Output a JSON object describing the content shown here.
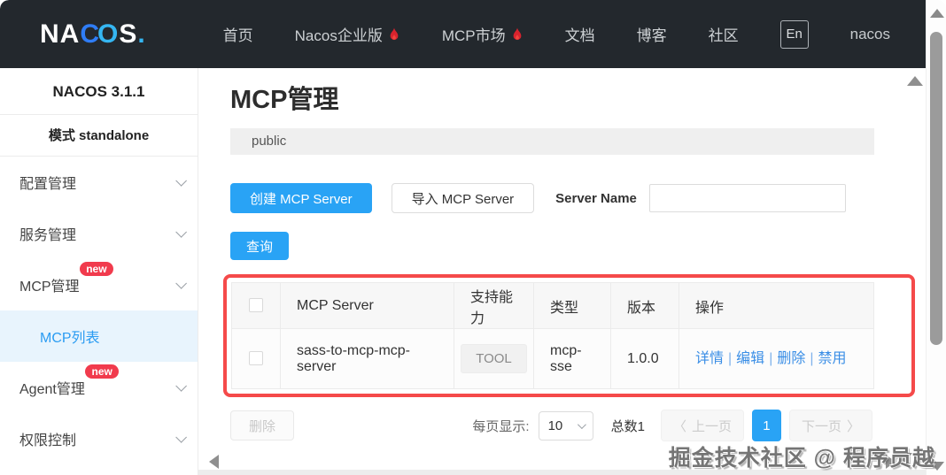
{
  "navbar": {
    "logo": {
      "na": "NA",
      "c": "C",
      "o": "O",
      "s": "S",
      "dot": "."
    },
    "menu": [
      {
        "label": "首页"
      },
      {
        "label": "Nacos企业版"
      },
      {
        "label": "MCP市场"
      },
      {
        "label": "文档"
      },
      {
        "label": "博客"
      },
      {
        "label": "社区"
      }
    ],
    "lang_button": "En",
    "username": "nacos"
  },
  "sidebar": {
    "version": "NACOS 3.1.1",
    "mode": "模式 standalone",
    "items": [
      {
        "label": "配置管理"
      },
      {
        "label": "服务管理"
      },
      {
        "label": "MCP管理",
        "badge": "new"
      },
      {
        "label": "Agent管理",
        "badge": "new"
      },
      {
        "label": "权限控制"
      }
    ],
    "submenu_selected": "MCP列表"
  },
  "main": {
    "title": "MCP管理",
    "namespace": "public",
    "toolbar": {
      "create_label": "创建 MCP Server",
      "import_label": "导入 MCP Server",
      "server_name_label": "Server Name",
      "search_value": "",
      "query_label": "查询"
    },
    "table": {
      "headers": [
        "MCP Server",
        "支持能力",
        "类型",
        "版本",
        "操作"
      ],
      "action_separator": "|",
      "rows": [
        {
          "name": "sass-to-mcp-mcp-server",
          "capability": "TOOL",
          "type": "mcp-sse",
          "version": "1.0.0",
          "actions": [
            "详情",
            "编辑",
            "删除",
            "禁用"
          ]
        }
      ]
    },
    "footer": {
      "delete_label": "删除",
      "page_size_label": "每页显示:",
      "page_size": "10",
      "total": "总数1",
      "prev_arrow": "〈",
      "prev_label": "上一页",
      "current_page": "1",
      "next_label": "下一页",
      "next_arrow": "〉"
    }
  },
  "watermark": "掘金技术社区 @ 程序员越",
  "colors": {
    "navbar_bg": "#23282d",
    "accent_blue": "#29a3f5",
    "highlight_red": "#f54a4a",
    "badge_red": "#f13b4d",
    "selected_item_bg": "#e8f4fd",
    "link_blue": "#3a8ee6"
  }
}
